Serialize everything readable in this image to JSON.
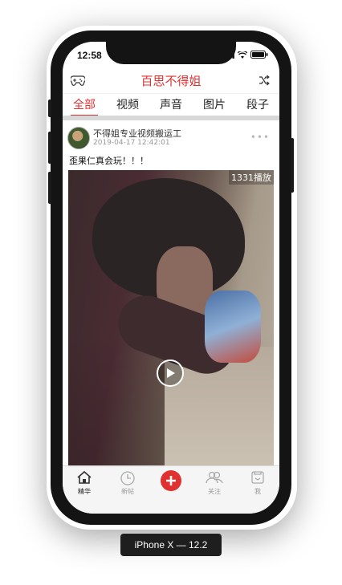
{
  "status_bar": {
    "time": "12:58"
  },
  "nav": {
    "title": "百思不得姐",
    "left_icon": "gamepad-icon",
    "right_icon": "shuffle-icon"
  },
  "tabs": [
    {
      "label": "全部",
      "active": true
    },
    {
      "label": "视频",
      "active": false
    },
    {
      "label": "声音",
      "active": false
    },
    {
      "label": "图片",
      "active": false
    },
    {
      "label": "段子",
      "active": false
    }
  ],
  "post": {
    "author": "不得姐专业视频搬运工",
    "time": "2019-04-17 12:42:01",
    "text": "歪果仁真会玩！！！",
    "play_count": "1331播放"
  },
  "tab_bar": [
    {
      "label": "精华",
      "icon": "home-icon",
      "active": true
    },
    {
      "label": "新帖",
      "icon": "clock-icon",
      "active": false
    },
    {
      "label": "",
      "icon": "plus-icon",
      "active": false
    },
    {
      "label": "关注",
      "icon": "people-icon",
      "active": false
    },
    {
      "label": "我",
      "icon": "profile-icon",
      "active": false
    }
  ],
  "device_label": "iPhone X — 12.2",
  "colors": {
    "accent": "#e03131"
  }
}
